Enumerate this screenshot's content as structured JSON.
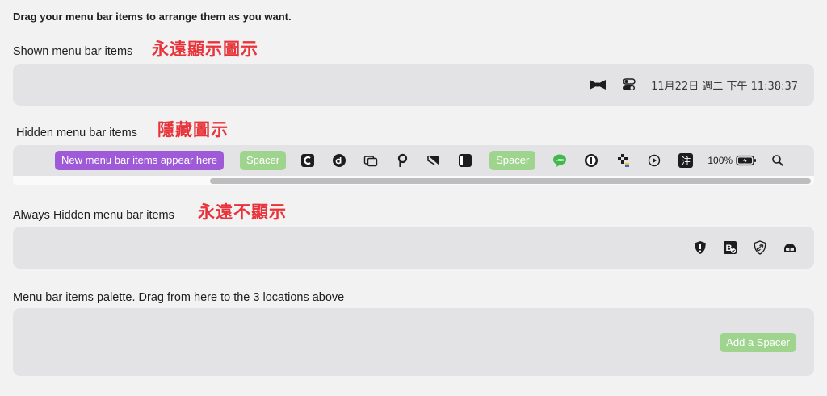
{
  "heading": "Drag your menu bar items to arrange them as you want.",
  "shown": {
    "label": "Shown menu bar items",
    "annotation": "永遠顯示圖示",
    "icons": [
      "bowtie-icon",
      "toggle-switch-icon"
    ],
    "clock": "11月22日 週二 下午 11:38:37"
  },
  "hidden": {
    "label": "Hidden menu bar items",
    "annotation": "隱藏圖示",
    "new_items_label": "New menu bar items appear here",
    "spacer_label": "Spacer",
    "icons_group1": [
      "c-square-icon",
      "d-circle-icon",
      "windows-icon",
      "pin-p-icon",
      "tilt-square-icon",
      "half-square-icon"
    ],
    "icons_group2": [
      "line-app-icon",
      "onepassword-icon",
      "dots-grid-icon",
      "play-circle-icon",
      "zhu-char-icon"
    ],
    "zhu_char": "注",
    "battery_percent": "100%",
    "icons_tail": [
      "battery-charging-icon",
      "search-icon"
    ]
  },
  "always_hidden": {
    "label": "Always Hidden menu bar items",
    "annotation": "永遠不顯示",
    "icons": [
      "shield-alert-icon",
      "b-check-icon",
      "shield-link-icon",
      "helmet-icon"
    ]
  },
  "palette": {
    "label": "Menu bar items palette. Drag from here to the 3 locations above",
    "add_spacer_label": "Add a Spacer"
  },
  "colors": {
    "annotation": "#e8333a",
    "spacer": "#9fd48f",
    "new_items": "#9f5ad8",
    "panel": "#e3e3e5"
  }
}
